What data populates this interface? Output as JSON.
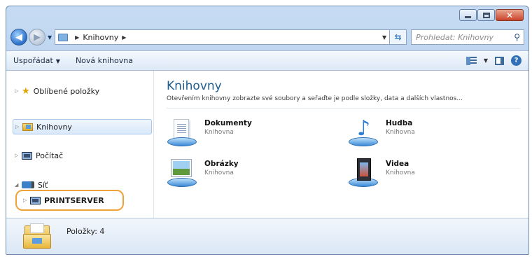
{
  "address": {
    "crumb": "Knihovny"
  },
  "search": {
    "placeholder": "Prohledat: Knihovny"
  },
  "toolbar": {
    "organize": "Uspořádat",
    "new_library": "Nová knihovna"
  },
  "sidebar": {
    "favorites": "Oblíbené položky",
    "libraries": "Knihovny",
    "computer": "Počítač",
    "network": "Síť",
    "printserver": "PRINTSERVER"
  },
  "main": {
    "title": "Knihovny",
    "description": "Otevřením knihovny zobrazte své soubory a seřaďte je podle složky, data a dalších vlastnos...",
    "tiles": [
      {
        "name": "Dokumenty",
        "sub": "Knihovna",
        "icon": "documents-library-icon"
      },
      {
        "name": "Hudba",
        "sub": "Knihovna",
        "icon": "music-library-icon"
      },
      {
        "name": "Obrázky",
        "sub": "Knihovna",
        "icon": "pictures-library-icon"
      },
      {
        "name": "Videa",
        "sub": "Knihovna",
        "icon": "videos-library-icon"
      }
    ]
  },
  "status": {
    "items": "Položky: 4"
  },
  "colors": {
    "highlight_ring": "#f0a23a",
    "title_blue": "#1e5d8f"
  }
}
